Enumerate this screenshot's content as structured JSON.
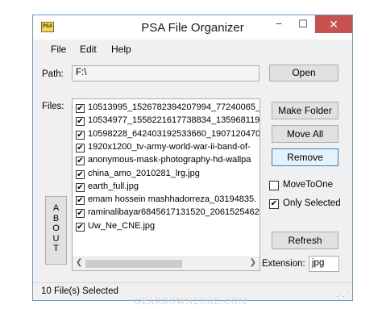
{
  "window": {
    "title": "PSA File Organizer",
    "app_icon_text": "PSA"
  },
  "titlebar_controls": {
    "minimize": "−",
    "maximize": "☐",
    "close": "✕"
  },
  "menu": {
    "items": [
      "File",
      "Edit",
      "Help"
    ]
  },
  "path": {
    "label": "Path:",
    "value": "F:\\"
  },
  "files": {
    "label": "Files:",
    "items": [
      {
        "name": "10513995_1526782394207994_77240065_",
        "checked": true
      },
      {
        "name": "10534977_1558221617738834_135968119",
        "checked": true
      },
      {
        "name": "10598228_642403192533660_1907120470",
        "checked": true
      },
      {
        "name": "1920x1200_tv-army-world-war-ii-band-of-",
        "checked": true
      },
      {
        "name": "anonymous-mask-photography-hd-wallpa",
        "checked": true
      },
      {
        "name": "china_amo_2010281_lrg.jpg",
        "checked": true
      },
      {
        "name": "earth_full.jpg",
        "checked": true
      },
      {
        "name": "emam hossein mashhadorreza_03194835.",
        "checked": true
      },
      {
        "name": "raminalibayar6845617131520_2061525462",
        "checked": true
      },
      {
        "name": "Uw_Ne_CNE.jpg",
        "checked": true
      }
    ]
  },
  "buttons": {
    "open": "Open",
    "make_folder": "Make Folder",
    "move_all": "Move All",
    "remove": "Remove",
    "refresh": "Refresh",
    "about": [
      "A",
      "B",
      "O",
      "U",
      "T"
    ]
  },
  "options": {
    "move_to_one": {
      "label": "MoveToOne",
      "checked": false
    },
    "only_selected": {
      "label": "Only Selected",
      "checked": true
    }
  },
  "extension": {
    "label": "Extension:",
    "value": "jpg"
  },
  "status": {
    "text": "10 File(s) Selected"
  },
  "watermark": "GEARDOWNLOAD.COM",
  "colors": {
    "close_button": "#c75050",
    "window_border": "#6b9ac4",
    "focus_border": "#3c7fb1"
  }
}
